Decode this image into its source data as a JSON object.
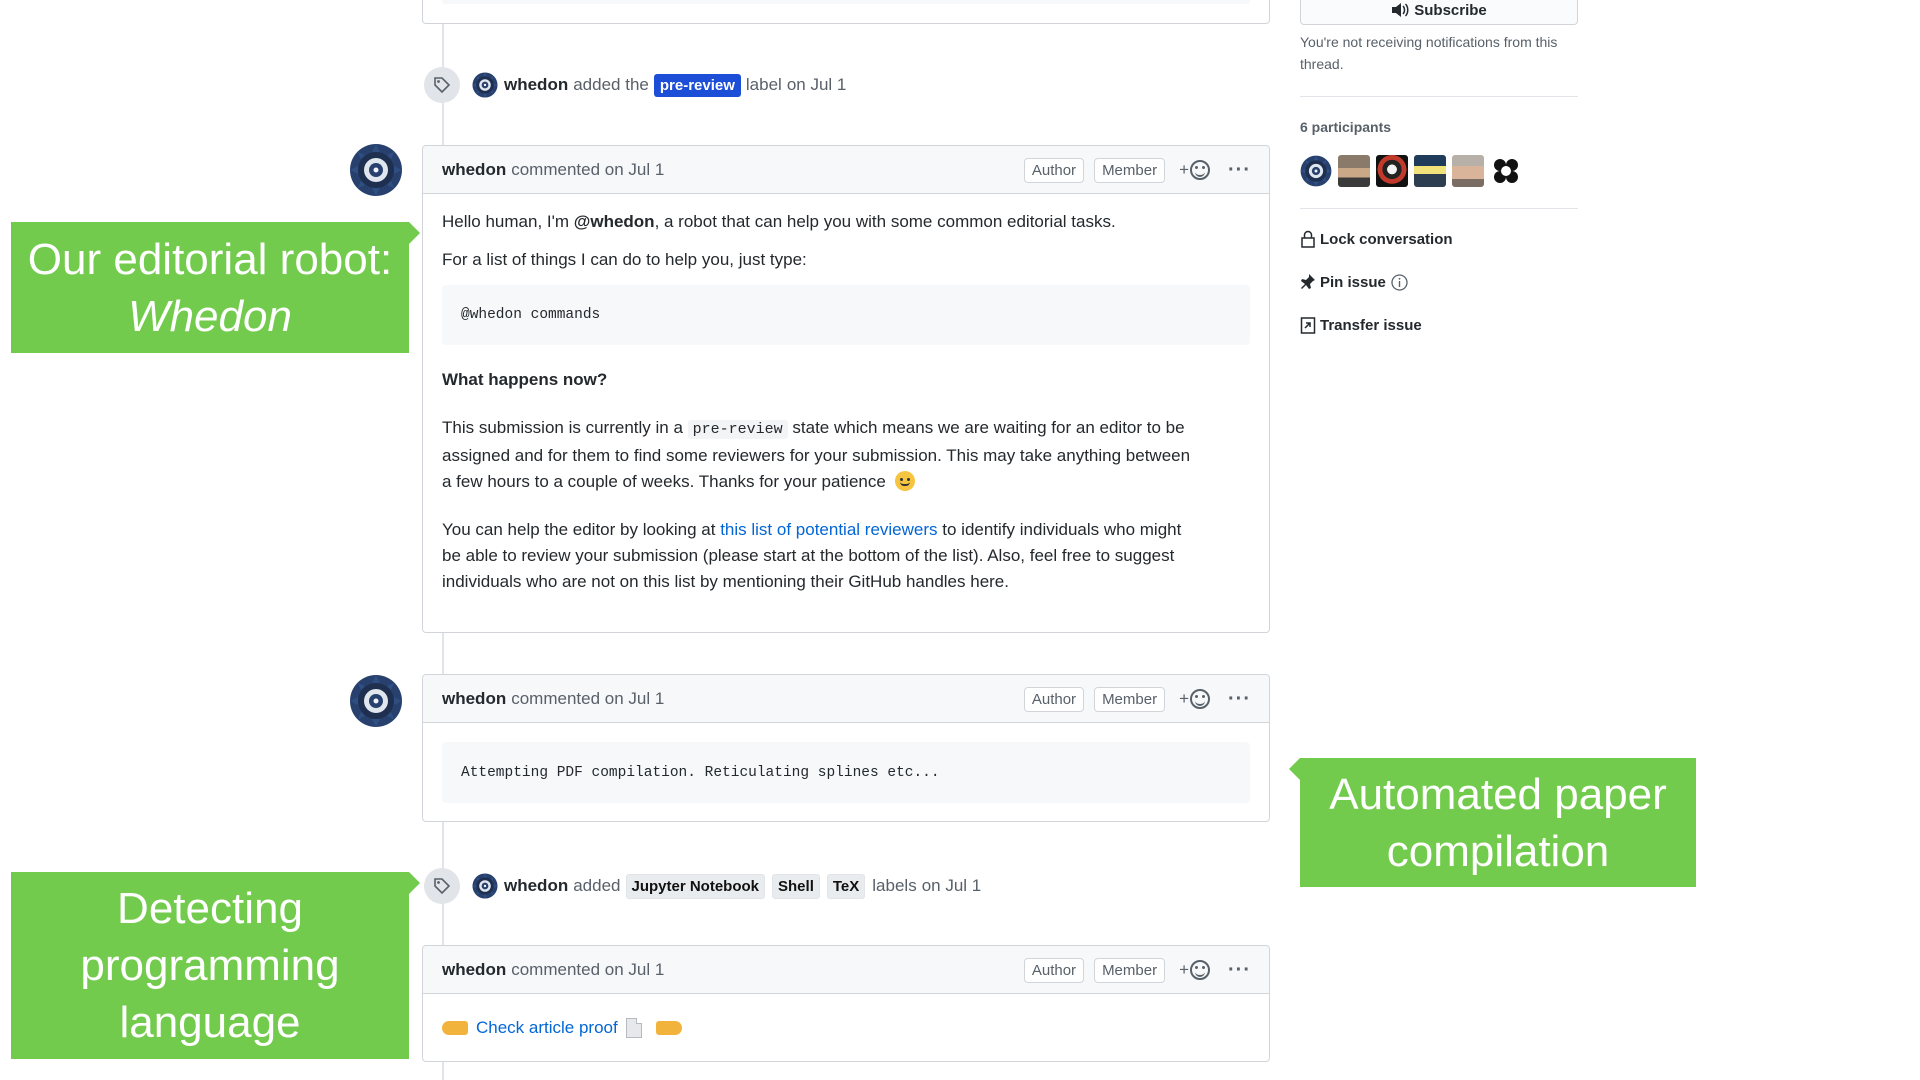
{
  "timeline": {
    "label_event": {
      "actor": "whedon",
      "text_before": "added the",
      "label": "pre-review",
      "text_after": "label",
      "date": "on Jul 1"
    },
    "comment1": {
      "author": "whedon",
      "action": "commented",
      "date": "on Jul 1",
      "badges": [
        "Author",
        "Member"
      ],
      "react_plus": "+",
      "more": "···",
      "greeting_prefix": "Hello human, I'm",
      "greeting_mention": "@whedon",
      "greeting_suffix": ", a robot that can help you with some common editorial tasks.",
      "help_line": "For a list of things I can do to help you, just type:",
      "code": "@whedon commands",
      "heading": "What happens now?",
      "para1_prefix": "This submission is currently in a",
      "para1_code": "pre-review",
      "para1_line1_rest": "state which means we are waiting for an editor to be",
      "para1_line2": "assigned and for them to find some reviewers for your submission. This may take anything between",
      "para1_line3": "a few hours to a couple of weeks. Thanks for your patience",
      "para2_prefix": "You can help the editor by looking at",
      "para2_link": "this list of potential reviewers",
      "para2_line1_rest": "to identify individuals who might",
      "para2_line2": "be able to review your submission (please start at the bottom of the list). Also, feel free to suggest",
      "para2_line3": "individuals who are not on this list by mentioning their GitHub handles here."
    },
    "comment2": {
      "author": "whedon",
      "action": "commented",
      "date": "on Jul 1",
      "badges": [
        "Author",
        "Member"
      ],
      "react_plus": "+",
      "more": "···",
      "code": "Attempting PDF compilation. Reticulating splines etc..."
    },
    "labels_event": {
      "actor": "whedon",
      "text_before": "added",
      "labels": [
        "Jupyter Notebook",
        "Shell",
        "TeX"
      ],
      "text_after": "labels",
      "date": "on Jul 1"
    },
    "comment3": {
      "author": "whedon",
      "action": "commented",
      "date": "on Jul 1",
      "badges": [
        "Author",
        "Member"
      ],
      "react_plus": "+",
      "more": "···",
      "link_text": "Check article proof"
    }
  },
  "callouts": {
    "robot": {
      "line1": "Our editorial robot:",
      "line2": "Whedon"
    },
    "compilation": {
      "line1": "Automated paper",
      "line2": "compilation"
    },
    "language": {
      "line1": "Detecting",
      "line2": "programming",
      "line3": "language"
    }
  },
  "sidebar": {
    "subscribe_label": "Subscribe",
    "notification_text": "You're not receiving notifications from this thread.",
    "participants_title": "6 participants",
    "actions": {
      "lock": "Lock conversation",
      "pin": "Pin issue",
      "transfer": "Transfer issue"
    }
  },
  "colors": {
    "callout_green": "#72cb4c",
    "label_blue": "#1d4ed8",
    "link_blue": "#0366d6"
  }
}
